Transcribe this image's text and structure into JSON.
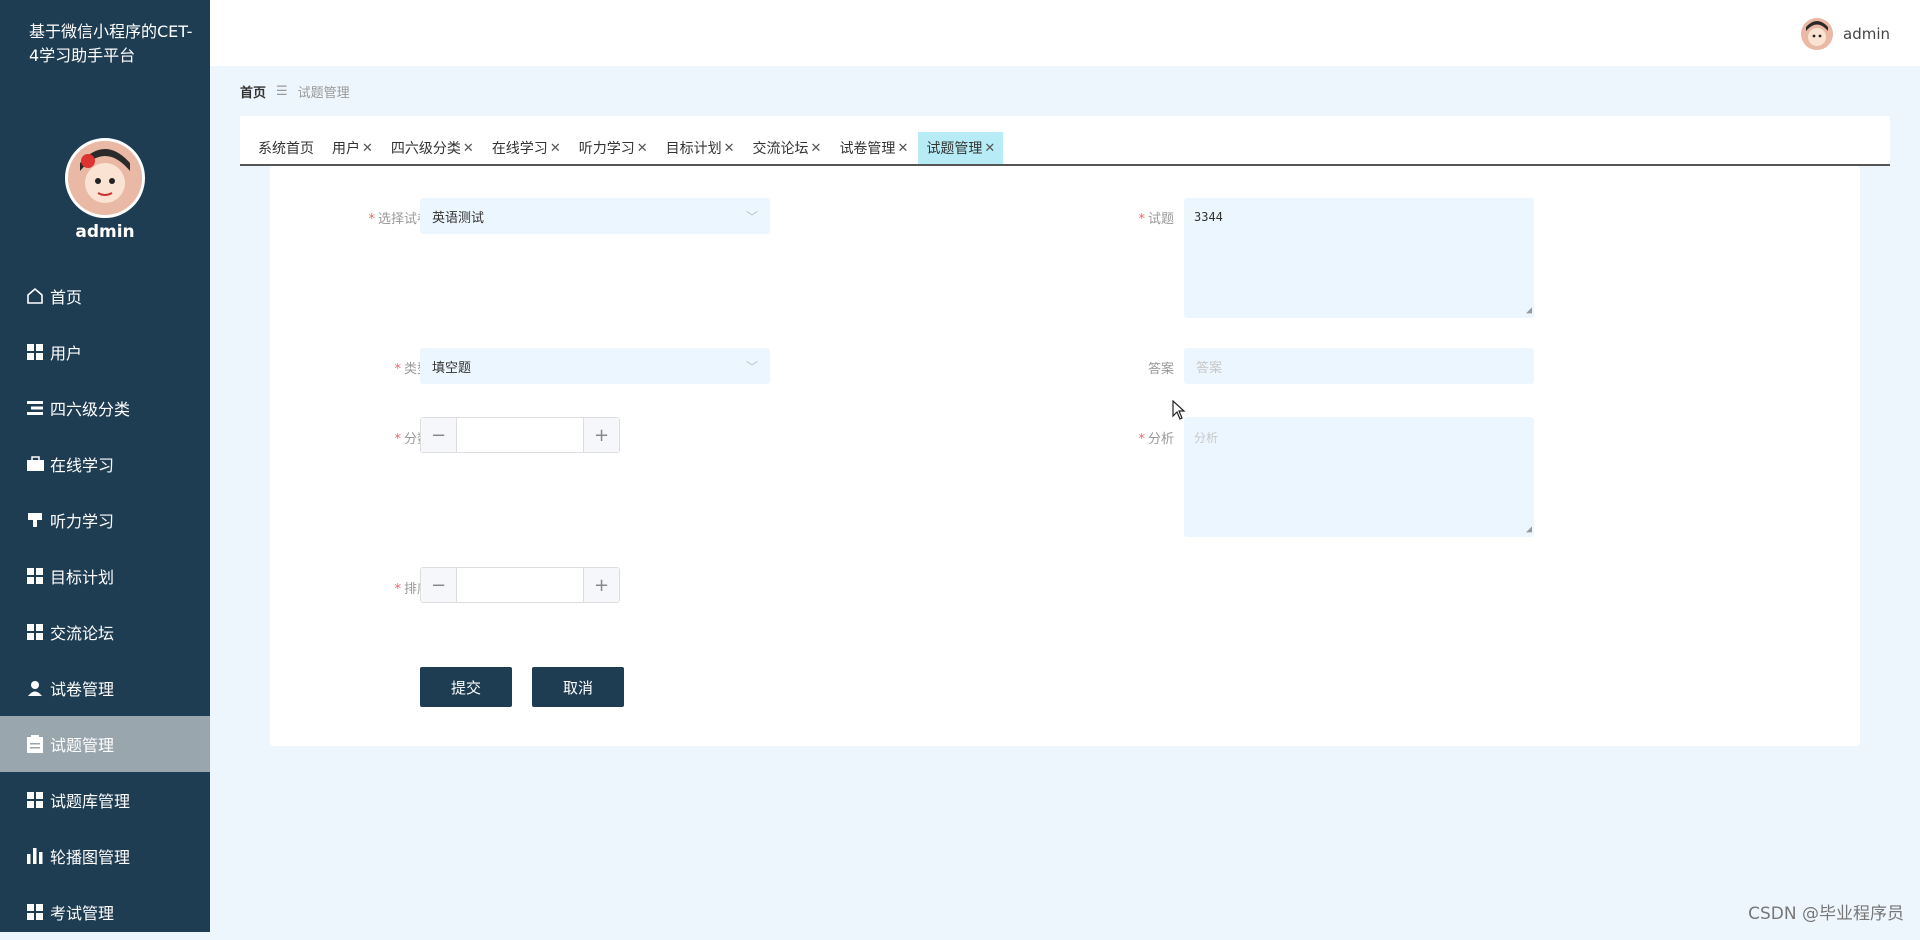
{
  "app": {
    "title": "基于微信小程序的CET-4学习助手平台"
  },
  "user": {
    "name": "admin"
  },
  "sidebar": {
    "items": [
      {
        "label": "首页",
        "icon": "home-icon"
      },
      {
        "label": "用户",
        "icon": "grid-icon"
      },
      {
        "label": "四六级分类",
        "icon": "list-icon"
      },
      {
        "label": "在线学习",
        "icon": "briefcase-icon"
      },
      {
        "label": "听力学习",
        "icon": "headphone-icon"
      },
      {
        "label": "目标计划",
        "icon": "grid-icon"
      },
      {
        "label": "交流论坛",
        "icon": "grid-icon"
      },
      {
        "label": "试卷管理",
        "icon": "user-icon"
      },
      {
        "label": "试题管理",
        "icon": "clipboard-icon",
        "active": true
      },
      {
        "label": "试题库管理",
        "icon": "grid-icon"
      },
      {
        "label": "轮播图管理",
        "icon": "bar-chart-icon"
      },
      {
        "label": "考试管理",
        "icon": "grid-icon"
      }
    ]
  },
  "breadcrumb": {
    "home": "首页",
    "separator": "☰",
    "current": "试题管理"
  },
  "tabs": [
    {
      "label": "系统首页",
      "closable": false
    },
    {
      "label": "用户",
      "closable": true
    },
    {
      "label": "四六级分类",
      "closable": true
    },
    {
      "label": "在线学习",
      "closable": true
    },
    {
      "label": "听力学习",
      "closable": true
    },
    {
      "label": "目标计划",
      "closable": true
    },
    {
      "label": "交流论坛",
      "closable": true
    },
    {
      "label": "试卷管理",
      "closable": true
    },
    {
      "label": "试题管理",
      "closable": true,
      "active": true
    }
  ],
  "form": {
    "paper": {
      "label": "选择试卷",
      "value": "英语测试"
    },
    "question": {
      "label": "试题",
      "value": "3344"
    },
    "type": {
      "label": "类型",
      "value": "填空题"
    },
    "answer": {
      "label": "答案",
      "placeholder": "答案"
    },
    "score": {
      "label": "分数",
      "value": ""
    },
    "analysis": {
      "label": "分析",
      "placeholder": "分析"
    },
    "order": {
      "label": "排序",
      "value": ""
    },
    "submit_label": "提交",
    "cancel_label": "取消",
    "required_mark": "*"
  },
  "watermark": "CSDN @毕业程序员",
  "colors": {
    "sidebar": "#1f3d52",
    "active_tab": "#b7ecf6",
    "field_bg": "#ecf6fe"
  }
}
